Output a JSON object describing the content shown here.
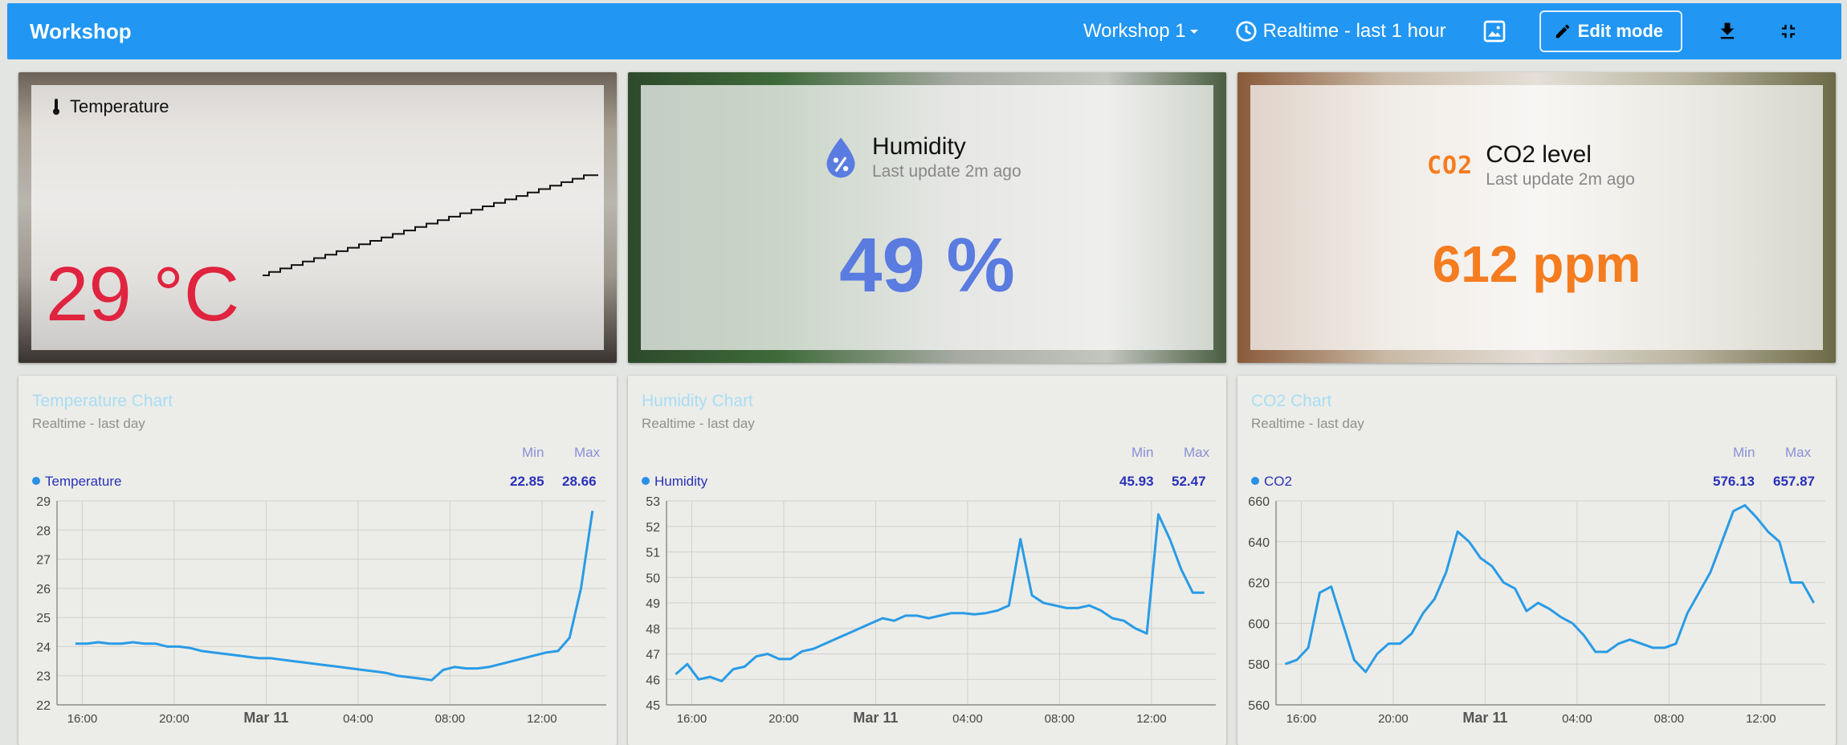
{
  "header": {
    "title": "Workshop",
    "dashboard_selector": "Workshop 1",
    "time_window": "Realtime - last 1 hour",
    "edit_mode_label": "Edit mode"
  },
  "cards": {
    "temperature": {
      "label": "Temperature",
      "value": "29 °C"
    },
    "humidity": {
      "label": "Humidity",
      "subtitle": "Last update 2m ago",
      "value": "49 %"
    },
    "co2": {
      "label": "CO2 level",
      "subtitle": "Last update 2m ago",
      "value": "612 ppm",
      "icon_text": "CO2"
    }
  },
  "colors": {
    "primary": "#2196f3",
    "temperature": "#e0243f",
    "humidity": "#5a7be0",
    "co2": "#f57c1f",
    "series_line": "#2a9be6"
  },
  "charts": {
    "legend_min": "Min",
    "legend_max": "Max",
    "temperature": {
      "title": "Temperature Chart",
      "subtitle": "Realtime - last day",
      "series": "Temperature",
      "min": "22.85",
      "max": "28.66"
    },
    "humidity": {
      "title": "Humidity Chart",
      "subtitle": "Realtime - last day",
      "series": "Humidity",
      "min": "45.93",
      "max": "52.47"
    },
    "co2": {
      "title": "CO2 Chart",
      "subtitle": "Realtime - last day",
      "series": "CO2",
      "min": "576.13",
      "max": "657.87"
    }
  },
  "chart_data": [
    {
      "type": "line",
      "title": "Temperature Chart",
      "x_ticks": [
        "16:00",
        "20:00",
        "Mar 11",
        "04:00",
        "08:00",
        "12:00"
      ],
      "x_hours": [
        0,
        4,
        8,
        12,
        16,
        20
      ],
      "ylim": [
        22,
        29
      ],
      "y_ticks": [
        22,
        23,
        24,
        25,
        26,
        27,
        28,
        29
      ],
      "grid": true,
      "series": [
        {
          "name": "Temperature",
          "x": [
            -0.3,
            0.2,
            0.7,
            1.2,
            1.7,
            2.2,
            2.7,
            3.2,
            3.7,
            4.2,
            4.7,
            5.2,
            5.7,
            6.2,
            6.7,
            7.2,
            7.7,
            8.2,
            8.7,
            9.2,
            9.7,
            10.2,
            10.7,
            11.2,
            11.7,
            12.2,
            12.7,
            13.2,
            13.7,
            14.2,
            14.7,
            15.2,
            15.7,
            16.2,
            16.7,
            17.2,
            17.7,
            18.2,
            18.7,
            19.2,
            19.7,
            20.2,
            20.7,
            21.2,
            21.7,
            22.2
          ],
          "y": [
            24.1,
            24.1,
            24.15,
            24.1,
            24.1,
            24.15,
            24.1,
            24.1,
            24.0,
            24.0,
            23.95,
            23.85,
            23.8,
            23.75,
            23.7,
            23.65,
            23.6,
            23.6,
            23.55,
            23.5,
            23.45,
            23.4,
            23.35,
            23.3,
            23.25,
            23.2,
            23.15,
            23.1,
            23.0,
            22.95,
            22.9,
            22.85,
            23.2,
            23.3,
            23.25,
            23.25,
            23.3,
            23.4,
            23.5,
            23.6,
            23.7,
            23.8,
            23.85,
            24.3,
            26.0,
            28.66
          ]
        }
      ]
    },
    {
      "type": "line",
      "title": "Humidity Chart",
      "x_ticks": [
        "16:00",
        "20:00",
        "Mar 11",
        "04:00",
        "08:00",
        "12:00"
      ],
      "x_hours": [
        0,
        4,
        8,
        12,
        16,
        20
      ],
      "ylim": [
        45,
        53
      ],
      "y_ticks": [
        45,
        46,
        47,
        48,
        49,
        50,
        51,
        52,
        53
      ],
      "grid": true,
      "series": [
        {
          "name": "Humidity",
          "x": [
            -0.7,
            -0.2,
            0.3,
            0.8,
            1.3,
            1.8,
            2.3,
            2.8,
            3.3,
            3.8,
            4.3,
            4.8,
            5.3,
            5.8,
            6.3,
            6.8,
            7.3,
            7.8,
            8.3,
            8.8,
            9.3,
            9.8,
            10.3,
            10.8,
            11.3,
            11.8,
            12.3,
            12.8,
            13.3,
            13.8,
            14.3,
            14.8,
            15.3,
            15.8,
            16.3,
            16.8,
            17.3,
            17.8,
            18.3,
            18.8,
            19.3,
            19.8,
            20.3,
            20.8,
            21.3,
            21.8,
            22.3
          ],
          "y": [
            46.2,
            46.6,
            46.0,
            46.1,
            45.93,
            46.4,
            46.5,
            46.9,
            47.0,
            46.8,
            46.8,
            47.1,
            47.2,
            47.4,
            47.6,
            47.8,
            48.0,
            48.2,
            48.4,
            48.3,
            48.5,
            48.5,
            48.4,
            48.5,
            48.6,
            48.6,
            48.55,
            48.6,
            48.7,
            48.9,
            51.5,
            49.3,
            49.0,
            48.9,
            48.8,
            48.8,
            48.9,
            48.7,
            48.4,
            48.3,
            48.0,
            47.8,
            52.47,
            51.5,
            50.3,
            49.4,
            49.4
          ]
        }
      ]
    },
    {
      "type": "line",
      "title": "CO2 Chart",
      "x_ticks": [
        "16:00",
        "20:00",
        "Mar 11",
        "04:00",
        "08:00",
        "12:00"
      ],
      "x_hours": [
        0,
        4,
        8,
        12,
        16,
        20
      ],
      "ylim": [
        560,
        660
      ],
      "y_ticks": [
        560,
        580,
        600,
        620,
        640,
        660
      ],
      "grid": true,
      "series": [
        {
          "name": "CO2",
          "x": [
            -0.7,
            -0.2,
            0.3,
            0.8,
            1.3,
            1.8,
            2.3,
            2.8,
            3.3,
            3.8,
            4.3,
            4.8,
            5.3,
            5.8,
            6.3,
            6.8,
            7.3,
            7.8,
            8.3,
            8.8,
            9.3,
            9.8,
            10.3,
            10.8,
            11.3,
            11.8,
            12.3,
            12.8,
            13.3,
            13.8,
            14.3,
            14.8,
            15.3,
            15.8,
            16.3,
            16.8,
            17.3,
            17.8,
            18.3,
            18.8,
            19.3,
            19.8,
            20.3,
            20.8,
            21.3,
            21.8,
            22.3
          ],
          "y": [
            580,
            582,
            588,
            615,
            618,
            600,
            582,
            576.13,
            585,
            590,
            590,
            595,
            605,
            612,
            625,
            645,
            640,
            632,
            628,
            620,
            617,
            606,
            610,
            607,
            603,
            600,
            594,
            586,
            586,
            590,
            592,
            590,
            588,
            588,
            590,
            605,
            615,
            625,
            640,
            655,
            657.87,
            652,
            645,
            640,
            620,
            620,
            610
          ]
        }
      ]
    }
  ]
}
